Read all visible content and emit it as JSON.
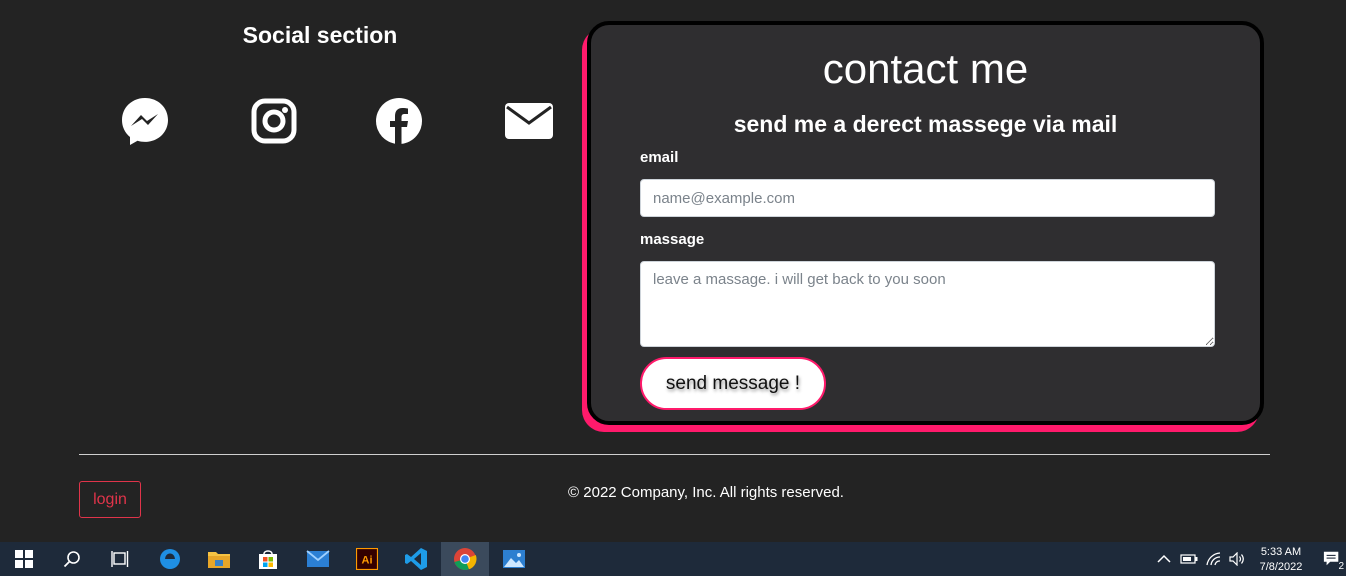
{
  "social": {
    "title": "Social section",
    "icons": [
      "messenger-icon",
      "instagram-icon",
      "facebook-icon",
      "mail-icon"
    ]
  },
  "contact": {
    "title": "contact me",
    "subtitle": "send me a derect massege via mail",
    "email_label": "email",
    "email_placeholder": "name@example.com",
    "message_label": "massage",
    "message_placeholder": "leave a massage. i will get back to you soon",
    "send_label": "send message !"
  },
  "footer": {
    "login_label": "login",
    "copyright": "© 2022 Company, Inc. All rights reserved."
  },
  "taskbar": {
    "apps": [
      "windows-start-icon",
      "search-icon",
      "task-view-icon",
      "edge-icon",
      "file-explorer-icon",
      "store-icon",
      "mail-app-icon",
      "illustrator-icon",
      "vscode-icon",
      "chrome-icon",
      "photos-icon"
    ],
    "illustrator_text": "Ai",
    "time": "5:33 AM",
    "date": "7/8/2022",
    "notification_count": "2"
  },
  "colors": {
    "background": "#232323",
    "accent": "#ff1a6b",
    "card": "#2f2e30",
    "login": "#e0344a"
  }
}
